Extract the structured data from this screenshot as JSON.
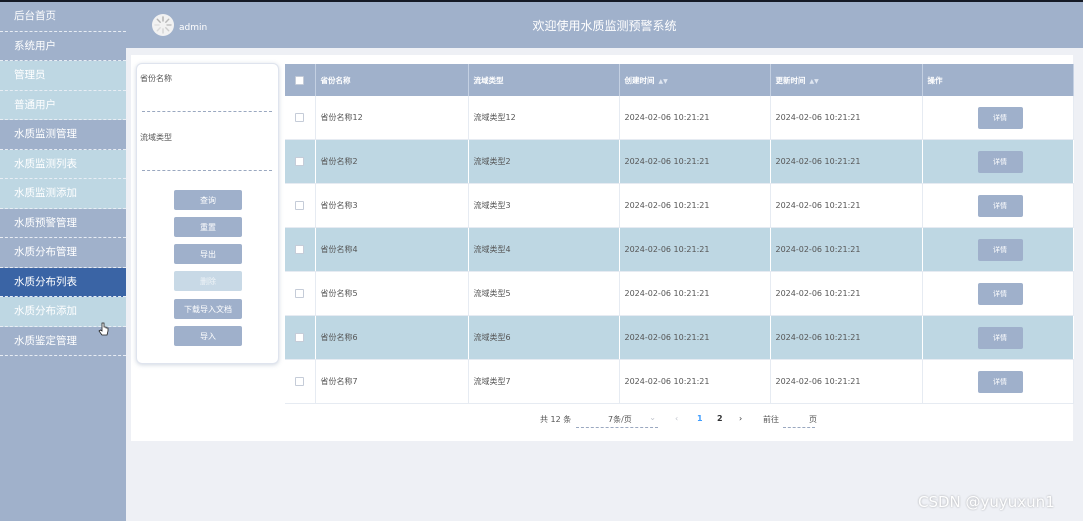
{
  "sidebar": {
    "items": [
      {
        "label": "后台首页",
        "type": "parent"
      },
      {
        "label": "系统用户",
        "type": "parent"
      },
      {
        "label": "管理员",
        "type": "child"
      },
      {
        "label": "普通用户",
        "type": "child"
      },
      {
        "label": "水质监测管理",
        "type": "parent"
      },
      {
        "label": "水质监测列表",
        "type": "child"
      },
      {
        "label": "水质监测添加",
        "type": "child"
      },
      {
        "label": "水质预警管理",
        "type": "parent"
      },
      {
        "label": "水质分布管理",
        "type": "parent"
      },
      {
        "label": "水质分布列表",
        "type": "active"
      },
      {
        "label": "水质分布添加",
        "type": "child"
      },
      {
        "label": "水质鉴定管理",
        "type": "parent"
      }
    ]
  },
  "header": {
    "username": "admin",
    "title": "欢迎使用水质监测预警系统"
  },
  "search": {
    "province_label": "省份名称",
    "province_value": "",
    "basin_label": "流域类型",
    "basin_value": "",
    "buttons": {
      "query": "查询",
      "reset": "重置",
      "export": "导出",
      "delete": "删除",
      "download_template": "下载导入文档",
      "import": "导入"
    }
  },
  "table": {
    "headers": {
      "province": "省份名称",
      "basin": "流域类型",
      "created": "创建时间",
      "updated": "更新时间",
      "actions": "操作"
    },
    "detail_label": "详情",
    "rows": [
      {
        "province": "省份名称12",
        "basin": "流域类型12",
        "created": "2024-02-06 10:21:21",
        "updated": "2024-02-06 10:21:21"
      },
      {
        "province": "省份名称2",
        "basin": "流域类型2",
        "created": "2024-02-06 10:21:21",
        "updated": "2024-02-06 10:21:21"
      },
      {
        "province": "省份名称3",
        "basin": "流域类型3",
        "created": "2024-02-06 10:21:21",
        "updated": "2024-02-06 10:21:21"
      },
      {
        "province": "省份名称4",
        "basin": "流域类型4",
        "created": "2024-02-06 10:21:21",
        "updated": "2024-02-06 10:21:21"
      },
      {
        "province": "省份名称5",
        "basin": "流域类型5",
        "created": "2024-02-06 10:21:21",
        "updated": "2024-02-06 10:21:21"
      },
      {
        "province": "省份名称6",
        "basin": "流域类型6",
        "created": "2024-02-06 10:21:21",
        "updated": "2024-02-06 10:21:21"
      },
      {
        "province": "省份名称7",
        "basin": "流域类型7",
        "created": "2024-02-06 10:21:21",
        "updated": "2024-02-06 10:21:21"
      }
    ]
  },
  "pagination": {
    "total": "共 12 条",
    "page_size": "7条/页",
    "prev": "‹",
    "pages": [
      "1",
      "2"
    ],
    "current_page": "1",
    "next": "›",
    "goto_label": "前往",
    "goto_suffix": "页",
    "goto_value": ""
  },
  "watermark": "CSDN @yuyuxun1",
  "colors": {
    "accent": "#a0b1cb",
    "active_nav": "#3a64a5",
    "row_stripe": "#bed7e3",
    "page_active": "#409eff"
  }
}
